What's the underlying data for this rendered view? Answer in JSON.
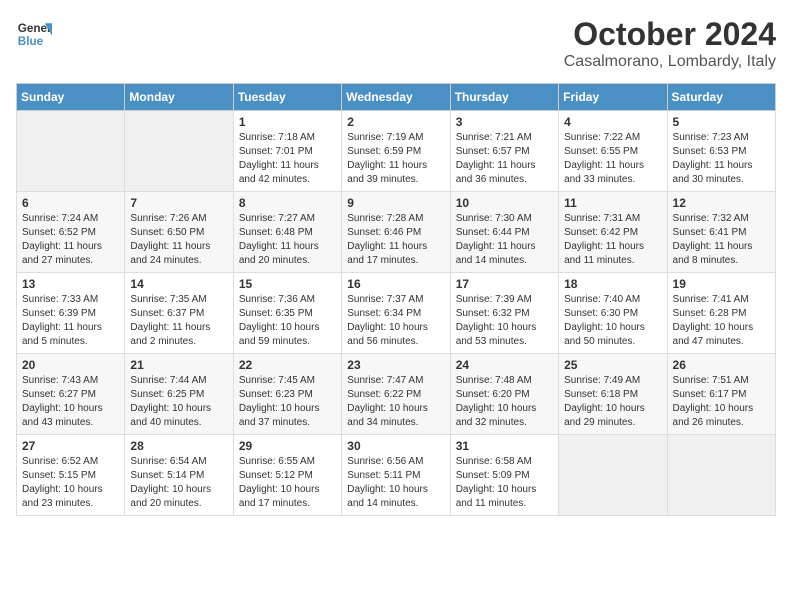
{
  "header": {
    "logo_line1": "General",
    "logo_line2": "Blue",
    "month": "October 2024",
    "location": "Casalmorano, Lombardy, Italy"
  },
  "days_of_week": [
    "Sunday",
    "Monday",
    "Tuesday",
    "Wednesday",
    "Thursday",
    "Friday",
    "Saturday"
  ],
  "weeks": [
    [
      {
        "day": "",
        "info": ""
      },
      {
        "day": "",
        "info": ""
      },
      {
        "day": "1",
        "info": "Sunrise: 7:18 AM\nSunset: 7:01 PM\nDaylight: 11 hours and 42 minutes."
      },
      {
        "day": "2",
        "info": "Sunrise: 7:19 AM\nSunset: 6:59 PM\nDaylight: 11 hours and 39 minutes."
      },
      {
        "day": "3",
        "info": "Sunrise: 7:21 AM\nSunset: 6:57 PM\nDaylight: 11 hours and 36 minutes."
      },
      {
        "day": "4",
        "info": "Sunrise: 7:22 AM\nSunset: 6:55 PM\nDaylight: 11 hours and 33 minutes."
      },
      {
        "day": "5",
        "info": "Sunrise: 7:23 AM\nSunset: 6:53 PM\nDaylight: 11 hours and 30 minutes."
      }
    ],
    [
      {
        "day": "6",
        "info": "Sunrise: 7:24 AM\nSunset: 6:52 PM\nDaylight: 11 hours and 27 minutes."
      },
      {
        "day": "7",
        "info": "Sunrise: 7:26 AM\nSunset: 6:50 PM\nDaylight: 11 hours and 24 minutes."
      },
      {
        "day": "8",
        "info": "Sunrise: 7:27 AM\nSunset: 6:48 PM\nDaylight: 11 hours and 20 minutes."
      },
      {
        "day": "9",
        "info": "Sunrise: 7:28 AM\nSunset: 6:46 PM\nDaylight: 11 hours and 17 minutes."
      },
      {
        "day": "10",
        "info": "Sunrise: 7:30 AM\nSunset: 6:44 PM\nDaylight: 11 hours and 14 minutes."
      },
      {
        "day": "11",
        "info": "Sunrise: 7:31 AM\nSunset: 6:42 PM\nDaylight: 11 hours and 11 minutes."
      },
      {
        "day": "12",
        "info": "Sunrise: 7:32 AM\nSunset: 6:41 PM\nDaylight: 11 hours and 8 minutes."
      }
    ],
    [
      {
        "day": "13",
        "info": "Sunrise: 7:33 AM\nSunset: 6:39 PM\nDaylight: 11 hours and 5 minutes."
      },
      {
        "day": "14",
        "info": "Sunrise: 7:35 AM\nSunset: 6:37 PM\nDaylight: 11 hours and 2 minutes."
      },
      {
        "day": "15",
        "info": "Sunrise: 7:36 AM\nSunset: 6:35 PM\nDaylight: 10 hours and 59 minutes."
      },
      {
        "day": "16",
        "info": "Sunrise: 7:37 AM\nSunset: 6:34 PM\nDaylight: 10 hours and 56 minutes."
      },
      {
        "day": "17",
        "info": "Sunrise: 7:39 AM\nSunset: 6:32 PM\nDaylight: 10 hours and 53 minutes."
      },
      {
        "day": "18",
        "info": "Sunrise: 7:40 AM\nSunset: 6:30 PM\nDaylight: 10 hours and 50 minutes."
      },
      {
        "day": "19",
        "info": "Sunrise: 7:41 AM\nSunset: 6:28 PM\nDaylight: 10 hours and 47 minutes."
      }
    ],
    [
      {
        "day": "20",
        "info": "Sunrise: 7:43 AM\nSunset: 6:27 PM\nDaylight: 10 hours and 43 minutes."
      },
      {
        "day": "21",
        "info": "Sunrise: 7:44 AM\nSunset: 6:25 PM\nDaylight: 10 hours and 40 minutes."
      },
      {
        "day": "22",
        "info": "Sunrise: 7:45 AM\nSunset: 6:23 PM\nDaylight: 10 hours and 37 minutes."
      },
      {
        "day": "23",
        "info": "Sunrise: 7:47 AM\nSunset: 6:22 PM\nDaylight: 10 hours and 34 minutes."
      },
      {
        "day": "24",
        "info": "Sunrise: 7:48 AM\nSunset: 6:20 PM\nDaylight: 10 hours and 32 minutes."
      },
      {
        "day": "25",
        "info": "Sunrise: 7:49 AM\nSunset: 6:18 PM\nDaylight: 10 hours and 29 minutes."
      },
      {
        "day": "26",
        "info": "Sunrise: 7:51 AM\nSunset: 6:17 PM\nDaylight: 10 hours and 26 minutes."
      }
    ],
    [
      {
        "day": "27",
        "info": "Sunrise: 6:52 AM\nSunset: 5:15 PM\nDaylight: 10 hours and 23 minutes."
      },
      {
        "day": "28",
        "info": "Sunrise: 6:54 AM\nSunset: 5:14 PM\nDaylight: 10 hours and 20 minutes."
      },
      {
        "day": "29",
        "info": "Sunrise: 6:55 AM\nSunset: 5:12 PM\nDaylight: 10 hours and 17 minutes."
      },
      {
        "day": "30",
        "info": "Sunrise: 6:56 AM\nSunset: 5:11 PM\nDaylight: 10 hours and 14 minutes."
      },
      {
        "day": "31",
        "info": "Sunrise: 6:58 AM\nSunset: 5:09 PM\nDaylight: 10 hours and 11 minutes."
      },
      {
        "day": "",
        "info": ""
      },
      {
        "day": "",
        "info": ""
      }
    ]
  ]
}
